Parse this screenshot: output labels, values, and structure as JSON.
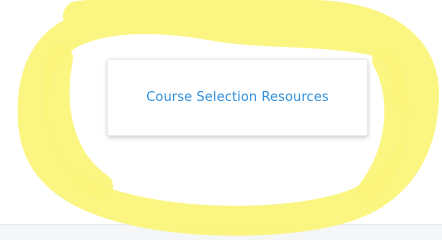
{
  "course_selection_card": {
    "link_label": "Course Selection Resources"
  },
  "annotation": {
    "highlight_color": "#fbf47a",
    "shape": "hand-drawn ellipse"
  },
  "theme": {
    "link_color": "#2f8fdd",
    "card_background": "#ffffff",
    "footer_band_color": "#f5f6f8"
  }
}
